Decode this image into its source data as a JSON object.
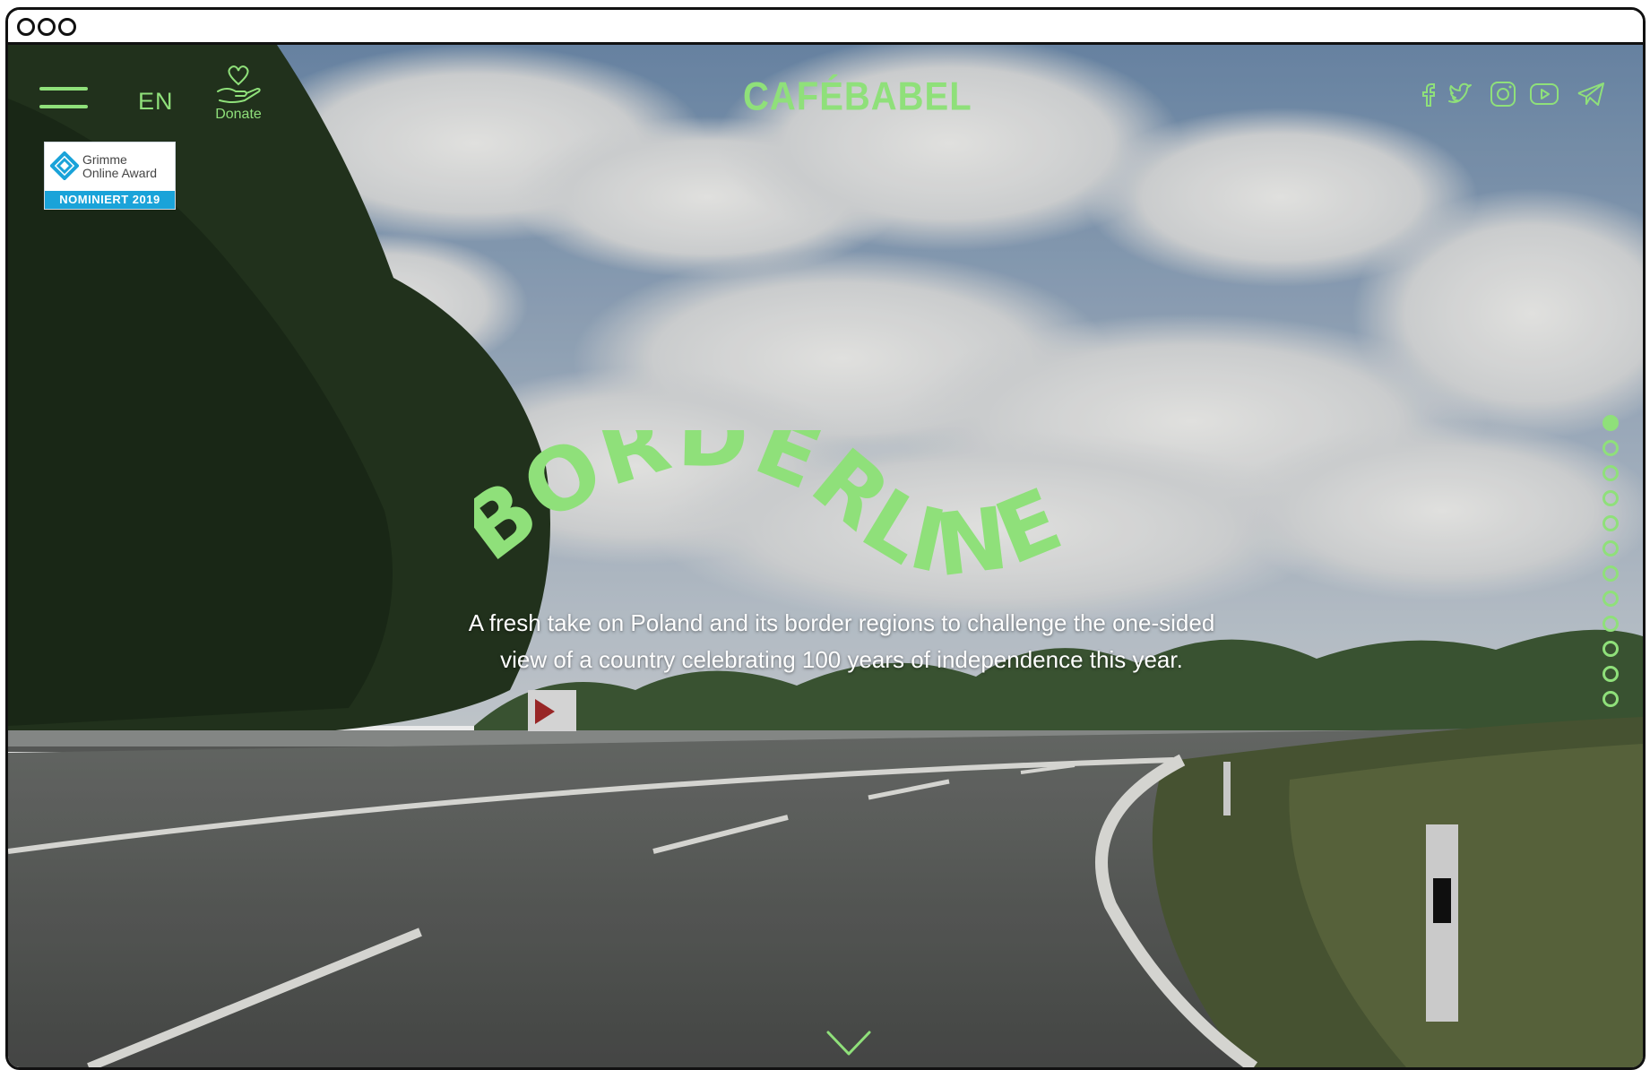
{
  "header": {
    "language": "EN",
    "donate_label": "Donate",
    "logo_text": "CAFÉBABEL",
    "social": [
      "facebook-icon",
      "twitter-icon",
      "instagram-icon",
      "youtube-icon",
      "telegram-icon"
    ]
  },
  "award_badge": {
    "line1": "Grimme",
    "line2": "Online Award",
    "line3": "NOMINIERT 2019"
  },
  "hero": {
    "title": "BORDERLINE",
    "tagline_line1": "A fresh take on Poland and its border regions to challenge the one-sided",
    "tagline_line2": "view of a country celebrating 100 years of independence this year."
  },
  "section_nav": {
    "count": 12,
    "active_index": 0
  },
  "colors": {
    "accent": "#8fe07a",
    "badge_blue": "#1aa3d9"
  }
}
